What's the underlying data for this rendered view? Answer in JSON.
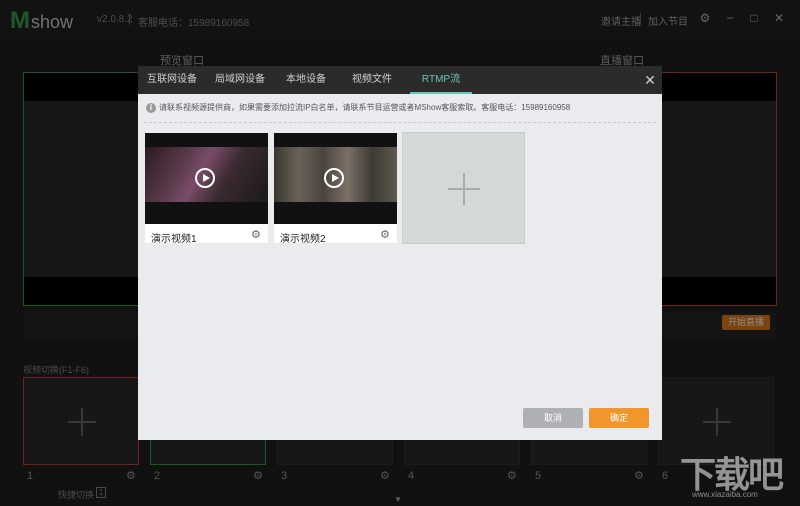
{
  "app": {
    "logo_m": "M",
    "logo_show": "show",
    "version": "v2.0.8.2",
    "hotline": "客服电话：15989160958",
    "links": [
      "邀请主播",
      "加入节目"
    ],
    "preview_label": "预览窗口",
    "program_label": "直播窗口",
    "live_button": "开始直播",
    "sources_label": "视频切换(F1-F6)",
    "slots": [
      {
        "num": "1"
      },
      {
        "num": "2"
      },
      {
        "num": "3"
      },
      {
        "num": "4"
      },
      {
        "num": "5"
      },
      {
        "num": "6"
      }
    ],
    "bottom_link": "快捷切换",
    "bottom_badge": "1"
  },
  "dialog": {
    "tabs": [
      {
        "label": "互联网设备",
        "active": false
      },
      {
        "label": "局域网设备",
        "active": false
      },
      {
        "label": "本地设备",
        "active": false
      },
      {
        "label": "视频文件",
        "active": false
      },
      {
        "label": "RTMP流",
        "active": true
      }
    ],
    "notice": "请联系视频源提供商，如果需要添加拉流IP白名单，请联系节目运营或者MShow客服索取。客服电话：15989160958",
    "videos": [
      {
        "name": "演示视频1"
      },
      {
        "name": "演示视频2"
      }
    ],
    "cancel_label": "取消",
    "ok_label": "确定"
  },
  "watermark": {
    "text": "下载吧",
    "url": "www.xiazaiba.com"
  },
  "colors": {
    "active_tab": "#6cc3b8",
    "ok_button": "#f2962c",
    "cancel_button": "#aeb1b4",
    "preview_border": "#3aa14a",
    "program_border": "#d73a3a",
    "live_button": "#e07b1a"
  },
  "icons": {
    "close": "close-icon",
    "info": "info-icon",
    "play": "play-icon",
    "gear": "gear-icon",
    "add": "plus-icon"
  }
}
